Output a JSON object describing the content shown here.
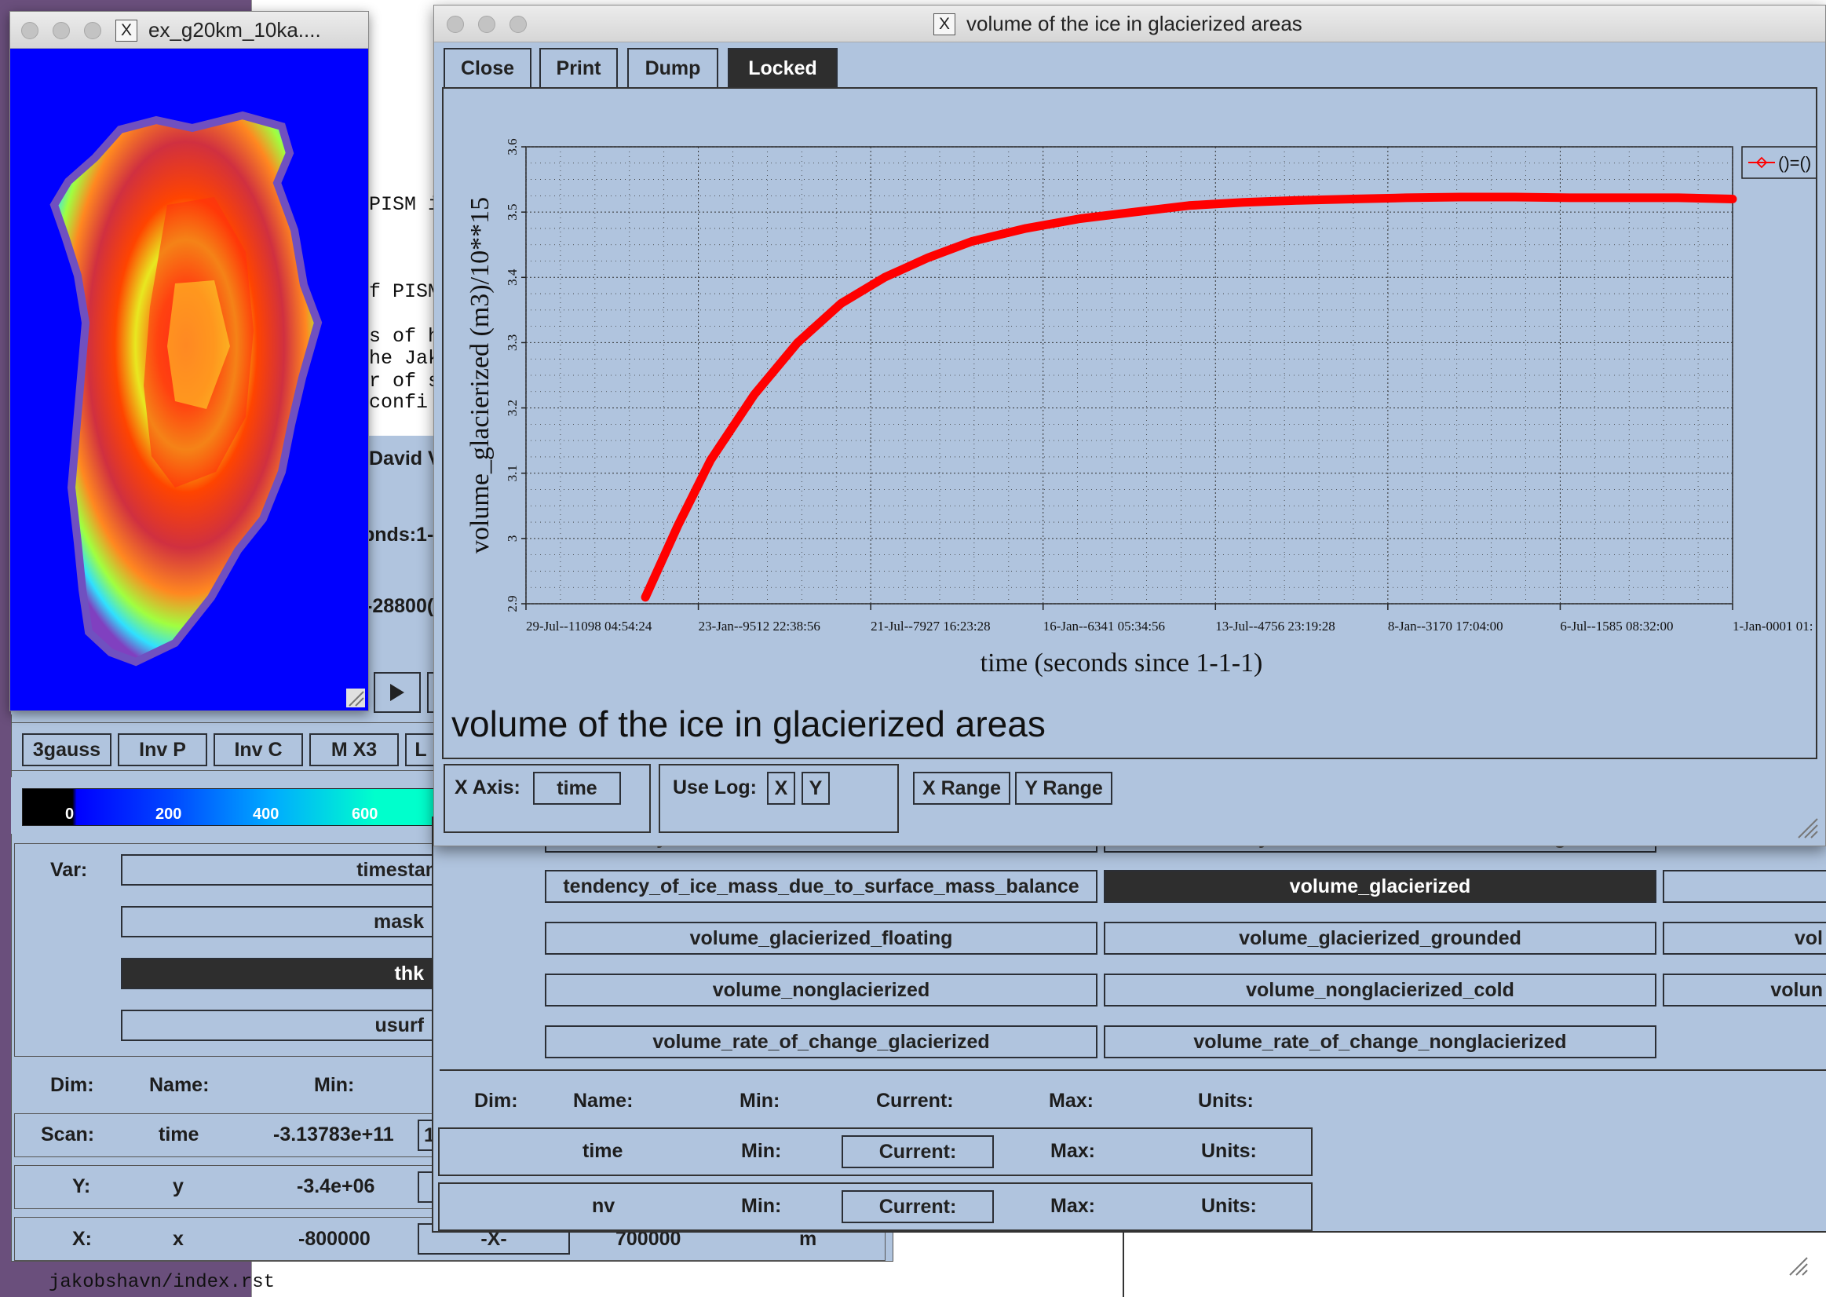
{
  "background_window": {
    "text_lines": [
      "PISM i",
      "f PISM",
      "s of h",
      "he Jak",
      "r of s",
      "confi"
    ],
    "david_label": "David V",
    "bnds_label": "bnds:1-",
    "neg_value": "-28800(",
    "bottom_text": "jakobshavn/index.rst"
  },
  "map_window": {
    "title": "ex_g20km_10ka....",
    "title_icon": "X"
  },
  "ncview_panel": {
    "colormap_buttons": [
      "3gauss",
      "Inv P",
      "Inv C",
      "M X3",
      "L"
    ],
    "colorbar_ticks": [
      "0",
      "200",
      "400",
      "600"
    ],
    "var_label": "Var:",
    "var_buttons": [
      "timestam",
      "mask",
      "thk",
      "usurf"
    ],
    "selected_var": "thk",
    "dim_headers": [
      "Dim:",
      "Name:",
      "Min:"
    ],
    "dim_rows": [
      {
        "dim": "Scan:",
        "name": "time",
        "min": "-3.13783e+11",
        "cur": "1"
      },
      {
        "dim": "Y:",
        "name": "y",
        "min": "-3.4e+06",
        "cur": ""
      },
      {
        "dim": "X:",
        "name": "x",
        "min": "-800000",
        "cur": "-X-",
        "max": "700000",
        "units": "m"
      }
    ]
  },
  "ts_panel": {
    "var_buttons": [
      [
        "tendency_of_ice_mass_due_to_surface_mass_balance",
        "volume_glacierized",
        ""
      ],
      [
        "volume_glacierized_floating",
        "volume_glacierized_grounded",
        "vol"
      ],
      [
        "volume_nonglacierized",
        "volume_nonglacierized_cold",
        "volun"
      ],
      [
        "volume_rate_of_change_glacierized",
        "volume_rate_of_change_nonglacierized",
        ""
      ]
    ],
    "hidden_row": [
      "tendency_of_ice_mass_due_to_conservation_error",
      "tendency_of_ice_mass_due_to_discharge"
    ],
    "selected": "volume_glacierized",
    "dim_headers": [
      "Dim:",
      "Name:",
      "Min:",
      "Current:",
      "Max:",
      "Units:"
    ],
    "dim_rows": [
      {
        "name": "time",
        "min": "Min:",
        "current": "Current:",
        "max": "Max:",
        "units": "Units:"
      },
      {
        "name": "nv",
        "min": "Min:",
        "current": "Current:",
        "max": "Max:",
        "units": "Units:"
      }
    ]
  },
  "plot_window": {
    "title": "volume of the ice in glacierized areas",
    "title_icon": "X",
    "toolbar": [
      "Close",
      "Print",
      "Dump",
      "Locked"
    ],
    "active_tool": "Locked",
    "plot_title": "volume of the ice in glacierized areas",
    "legend": "()=()",
    "x_axis_label": "X Axis:",
    "x_axis_value": "time",
    "use_log_label": "Use Log:",
    "log_x": "X",
    "log_y": "Y",
    "x_range": "X Range",
    "y_range": "Y Range"
  },
  "chart_data": {
    "type": "line",
    "xlabel": "time (seconds since 1-1-1)",
    "ylabel": "volume_glacierized (m3)/10**15",
    "x_tick_labels": [
      "29-Jul--11098 04:54:24",
      "23-Jan--9512 22:38:56",
      "21-Jul--7927 16:23:28",
      "16-Jan--6341 05:34:56",
      "13-Jul--4756 23:19:28",
      "8-Jan--3170 17:04:00",
      "6-Jul--1585 08:32:00",
      "1-Jan-0001 01:"
    ],
    "y_tick_labels": [
      "2.9",
      "3",
      "3.1",
      "3.2",
      "3.3",
      "3.4",
      "3.5",
      "3.6"
    ],
    "ylim": [
      2.9,
      3.6
    ],
    "xlim_years": [
      -11098,
      0
    ],
    "grid": true,
    "legend_placement": "top-right",
    "line_color": "#ff0000",
    "series": [
      {
        "name": "()=()",
        "x_years": [
          -10000,
          -9700,
          -9400,
          -9000,
          -8600,
          -8200,
          -7800,
          -7400,
          -7000,
          -6500,
          -6000,
          -5500,
          -5000,
          -4500,
          -4000,
          -3500,
          -3000,
          -2500,
          -2000,
          -1500,
          -1000,
          -500,
          0
        ],
        "values": [
          2.91,
          3.02,
          3.12,
          3.22,
          3.3,
          3.36,
          3.4,
          3.43,
          3.455,
          3.475,
          3.49,
          3.5,
          3.51,
          3.515,
          3.518,
          3.52,
          3.522,
          3.523,
          3.523,
          3.522,
          3.522,
          3.522,
          3.52
        ]
      }
    ]
  },
  "colors": {
    "panel": "#b0c4de",
    "selected": "#2e2e2e",
    "ice_ocean": "#0000ff",
    "line": "#ff0000"
  }
}
